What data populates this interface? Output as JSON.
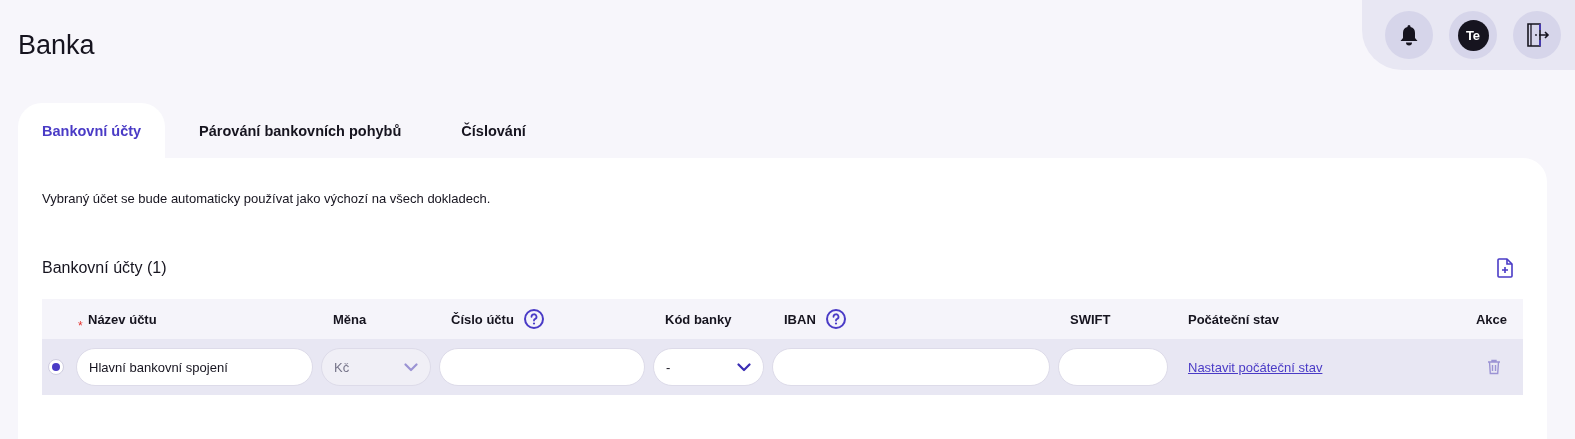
{
  "page_title": "Banka",
  "header_actions": {
    "avatar_initials": "Te"
  },
  "tabs": [
    {
      "label": "Bankovní účty",
      "selected": true
    },
    {
      "label": "Párování bankovních pohybů",
      "selected": false
    },
    {
      "label": "Číslování",
      "selected": false
    }
  ],
  "info_text": "Vybraný účet se bude automaticky používat jako výchozí na všech dokladech.",
  "section_title": "Bankovní účty (1)",
  "table": {
    "columns": [
      {
        "label": "Název účtu",
        "required_mark": "*",
        "help": false
      },
      {
        "label": "Měna",
        "help": false
      },
      {
        "label": "Číslo účtu",
        "help": true
      },
      {
        "label": "Kód banky",
        "help": false
      },
      {
        "label": "IBAN",
        "help": true
      },
      {
        "label": "SWIFT",
        "help": false
      },
      {
        "label": "Počáteční stav",
        "help": false
      },
      {
        "label": "Akce",
        "help": false
      }
    ],
    "rows": [
      {
        "selected": true,
        "name": "Hlavní bankovní spojení",
        "currency": {
          "value": "Kč",
          "disabled": true
        },
        "bank_code": {
          "value": "-",
          "disabled": false
        },
        "initial_state_link": "Nastavit počáteční stav"
      }
    ]
  }
}
